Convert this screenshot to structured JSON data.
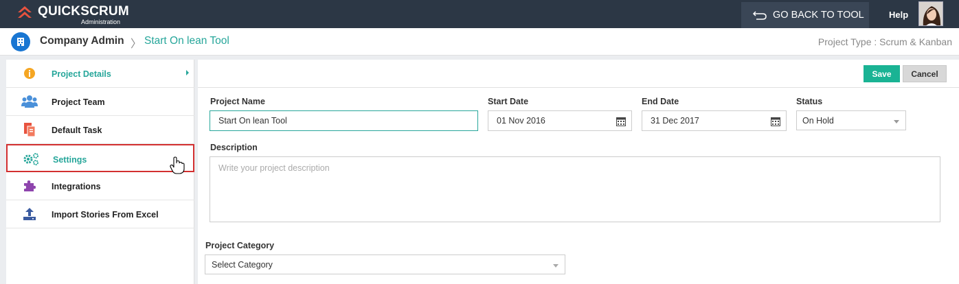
{
  "header": {
    "logo_text": "QUICKSCRUM",
    "logo_sub": "Administration",
    "back_button": "GO BACK TO TOOL",
    "help": "Help"
  },
  "breadcrumb": {
    "company": "Company Admin",
    "separator": "〉",
    "project": "Start On lean Tool",
    "project_type": "Project Type : Scrum & Kanban"
  },
  "sidebar": {
    "items": [
      {
        "label": "Project Details",
        "icon": "info-icon"
      },
      {
        "label": "Project Team",
        "icon": "team-icon"
      },
      {
        "label": "Default Task",
        "icon": "task-icon"
      },
      {
        "label": "Settings",
        "icon": "gears-icon"
      },
      {
        "label": "Integrations",
        "icon": "puzzle-icon"
      },
      {
        "label": "Import Stories From Excel",
        "icon": "upload-icon"
      }
    ]
  },
  "actions": {
    "save": "Save",
    "cancel": "Cancel"
  },
  "form": {
    "project_name": {
      "label": "Project Name",
      "value": "Start On lean Tool"
    },
    "start_date": {
      "label": "Start Date",
      "value": "01 Nov 2016"
    },
    "end_date": {
      "label": "End Date",
      "value": "31 Dec 2017"
    },
    "status": {
      "label": "Status",
      "value": "On Hold"
    },
    "description": {
      "label": "Description",
      "placeholder": "Write your project description"
    },
    "category": {
      "label": "Project Category",
      "value": "Select Category"
    }
  },
  "colors": {
    "topbar": "#2c3745",
    "accent": "#26a69a",
    "save": "#1ab394",
    "highlight": "#d32f2f"
  }
}
